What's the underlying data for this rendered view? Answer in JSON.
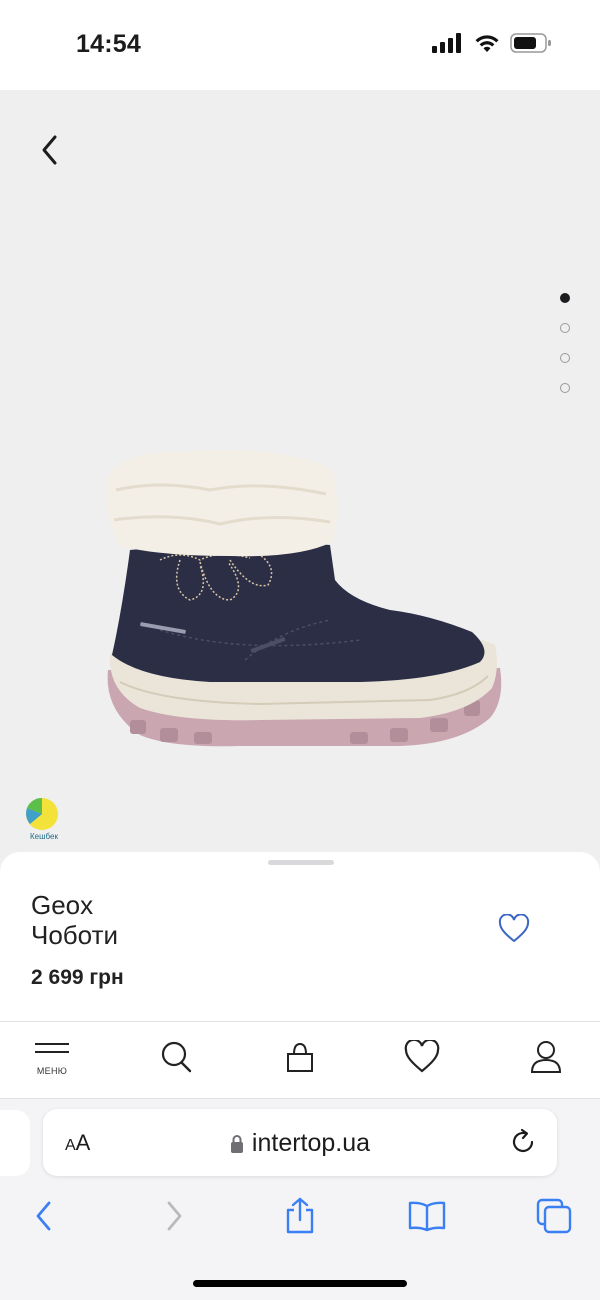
{
  "status_bar": {
    "time": "14:54",
    "icons": [
      "cellular-icon",
      "wifi-icon",
      "battery-icon"
    ]
  },
  "product": {
    "image_alt": "boot-image",
    "carousel": {
      "total": 4,
      "active": 1
    },
    "cashback_label": "Кешбек",
    "brand": "Geox",
    "type": "Чоботи",
    "price": "2 699 грн",
    "favorite_icon": "heart-outline-icon"
  },
  "tabbar": {
    "menu_label": "МЕНЮ",
    "icons": [
      "menu-icon",
      "search-icon",
      "bag-icon",
      "heart-icon",
      "user-icon"
    ]
  },
  "safari": {
    "aa_label": "AA",
    "url": "intertop.ua",
    "buttons": [
      "back-icon",
      "forward-icon",
      "share-icon",
      "bookmarks-icon",
      "tabs-icon"
    ]
  },
  "colors": {
    "accent": "#3b66c4",
    "safari_blue": "#3a7ff3",
    "hero_background": "#efeff0",
    "boot_navy": "#2b2e44",
    "sole_pink": "#c9a6b0"
  }
}
